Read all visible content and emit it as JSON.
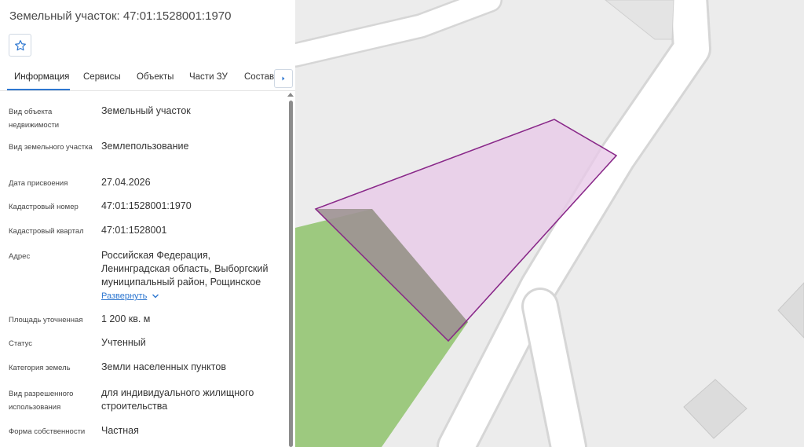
{
  "header": {
    "title": "Земельный участок: 47:01:1528001:1970"
  },
  "tabs": [
    {
      "label": "Информация",
      "active": true
    },
    {
      "label": "Сервисы",
      "active": false
    },
    {
      "label": "Объекты",
      "active": false
    },
    {
      "label": "Части ЗУ",
      "active": false
    },
    {
      "label": "Состав",
      "active": false
    }
  ],
  "rows": [
    {
      "label": "Вид объекта недвижимости",
      "value": "Земельный участок"
    },
    {
      "label": "Вид земельного участка",
      "value": "Землепользование"
    },
    {
      "label": "Дата присвоения",
      "value": "27.04.2026"
    },
    {
      "label": "Кадастровый номер",
      "value": "47:01:1528001:1970"
    },
    {
      "label": "Кадастровый квартал",
      "value": "47:01:1528001"
    },
    {
      "label": "Адрес",
      "value": "Российская Федерация, Ленинградская область, Выборгский муниципальный район, Рощинское"
    },
    {
      "label": "Площадь уточненная",
      "value": "1 200 кв. м"
    },
    {
      "label": "Статус",
      "value": "Учтенный"
    },
    {
      "label": "Категория земель",
      "value": "Земли населенных пунктов"
    },
    {
      "label": "Вид разрешенного использования",
      "value": "для индивидуального жилищного строительства"
    },
    {
      "label": "Форма собственности",
      "value": "Частная"
    }
  ],
  "address_expand_label": "Развернуть",
  "colors": {
    "accent": "#2e77d0",
    "parcel_fill": "#e8c9e8",
    "parcel_stroke": "#8a2a8a",
    "green_zone": "#9dc97f",
    "map_bg": "#ececec",
    "road": "#ffffff"
  },
  "icons": {
    "favorite": "star-icon",
    "tabs_scroll": "chevron-right-icon",
    "expand": "chevron-down-icon"
  }
}
